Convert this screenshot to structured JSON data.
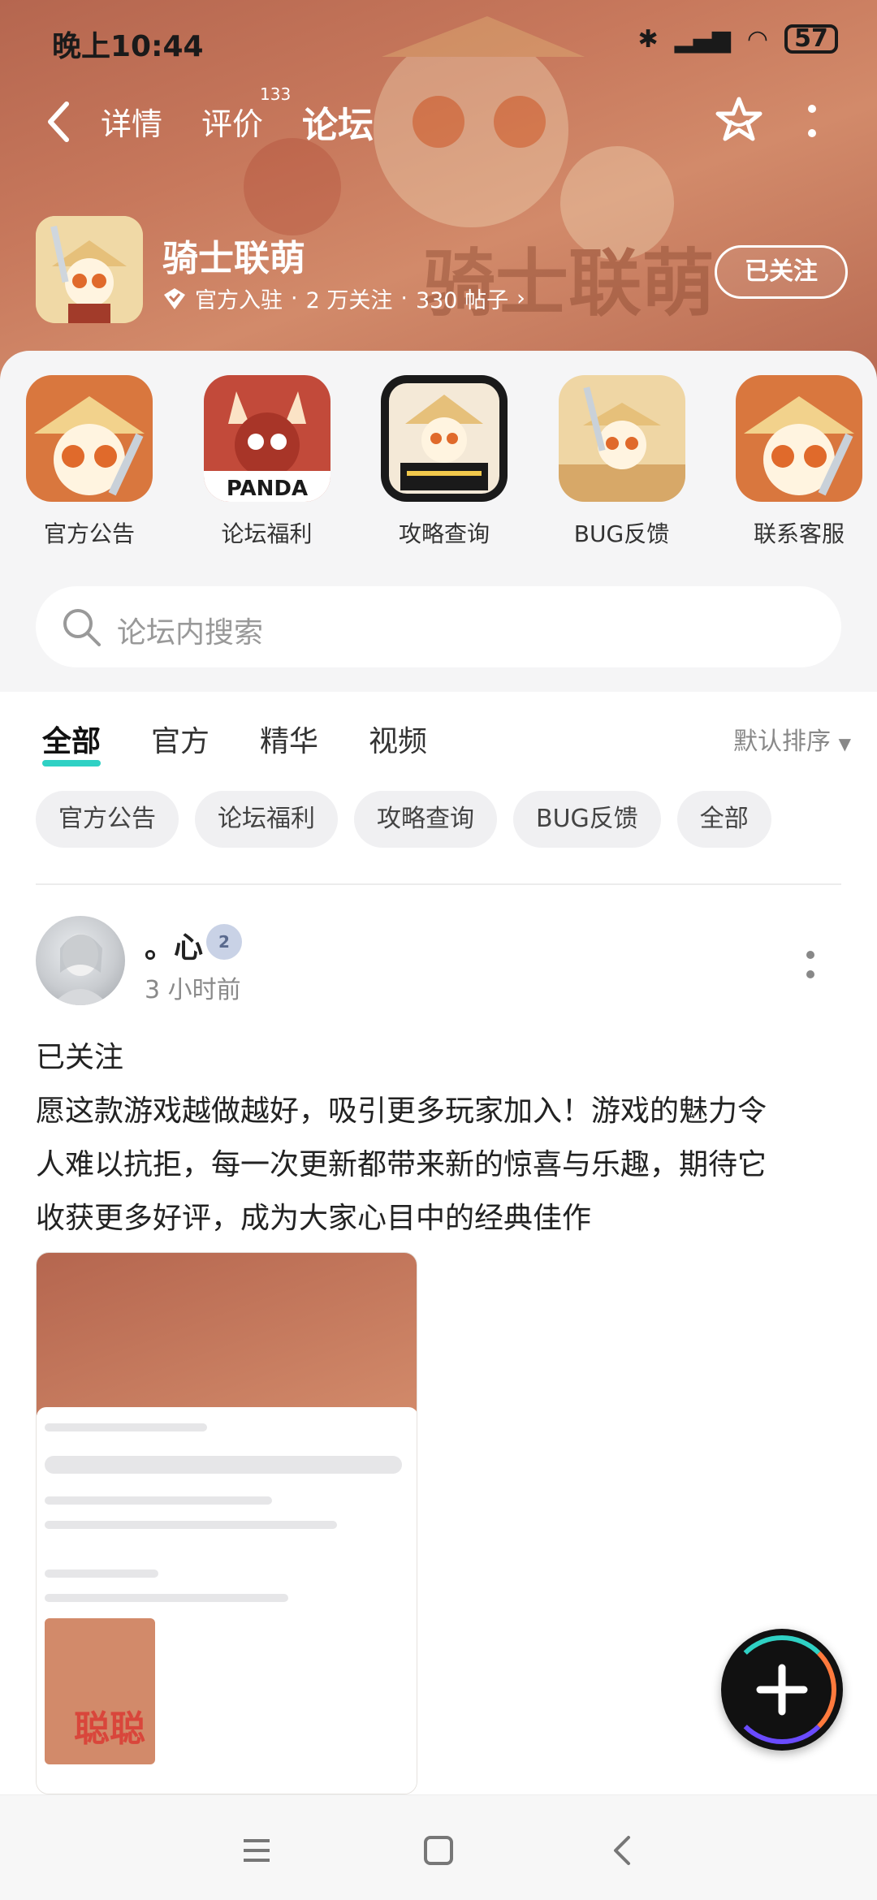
{
  "status_bar": {
    "time": "晚上10:44",
    "battery": "57",
    "icons": [
      "bluetooth-icon",
      "signal-icon",
      "wifi-icon",
      "battery-icon"
    ]
  },
  "nav": {
    "tabs": [
      {
        "label": "详情"
      },
      {
        "label": "评价",
        "badge": "133"
      },
      {
        "label": "论坛"
      }
    ],
    "active_tab": "论坛"
  },
  "game": {
    "name": "骑士联萌",
    "official_label": "官方入驻",
    "followers": "2 万关注",
    "posts": "330 帖子",
    "follow_status": "已关注"
  },
  "shortcuts": [
    {
      "label": "官方公告"
    },
    {
      "label": "论坛福利",
      "icon_text": "PANDA"
    },
    {
      "label": "攻略查询"
    },
    {
      "label": "BUG反馈"
    },
    {
      "label": "联系客服"
    }
  ],
  "search": {
    "placeholder": "论坛内搜索"
  },
  "filter_tabs": [
    {
      "label": "全部"
    },
    {
      "label": "官方"
    },
    {
      "label": "精华"
    },
    {
      "label": "视频"
    }
  ],
  "active_filter": "全部",
  "sort_label": "默认排序",
  "chips": [
    "官方公告",
    "论坛福利",
    "攻略查询",
    "BUG反馈",
    "全部"
  ],
  "post": {
    "username": "。心",
    "level": "2",
    "time": "3 小时前",
    "lines": [
      "已关注",
      "愿这款游戏越做越好，吸引更多玩家加入！游戏的魅力令",
      "人难以抗拒，每一次更新都带来新的惊喜与乐趣，期待它",
      "收获更多好评，成为大家心目中的经典佳作"
    ],
    "image_watermark": "聪聪"
  },
  "colors": {
    "accent": "#2fd1c4",
    "banner": "#c7785c",
    "chip_bg": "#f0f0f2"
  }
}
